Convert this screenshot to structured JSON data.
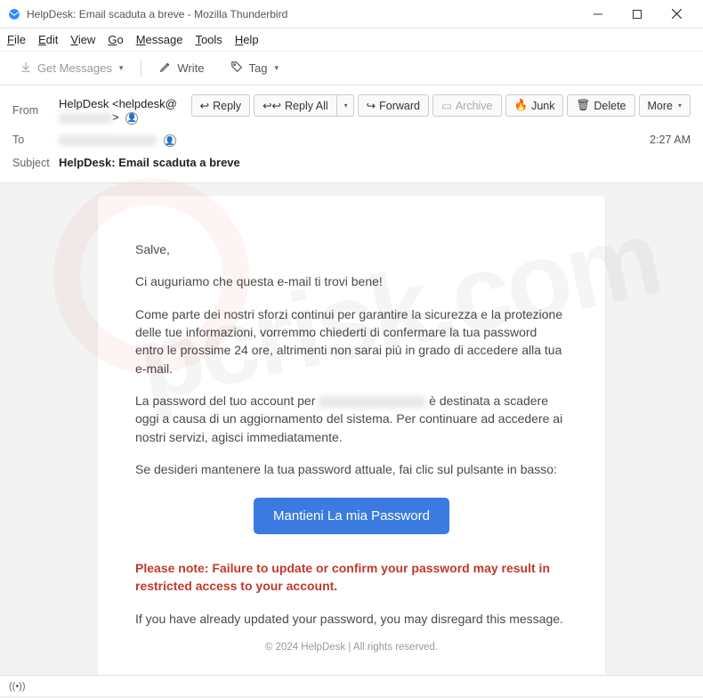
{
  "window": {
    "title": "HelpDesk: Email scaduta a breve - Mozilla Thunderbird"
  },
  "menu": {
    "file": "File",
    "edit": "Edit",
    "view": "View",
    "go": "Go",
    "message": "Message",
    "tools": "Tools",
    "help": "Help"
  },
  "toolbar": {
    "get_messages": "Get Messages",
    "write": "Write",
    "tag": "Tag"
  },
  "actions": {
    "reply": "Reply",
    "reply_all": "Reply All",
    "forward": "Forward",
    "archive": "Archive",
    "junk": "Junk",
    "delete": "Delete",
    "more": "More"
  },
  "headers": {
    "from_label": "From",
    "from_name": "HelpDesk",
    "from_prefix": "<helpdesk@",
    "from_suffix": ">",
    "to_label": "To",
    "subject_label": "Subject",
    "subject": "HelpDesk: Email scaduta a breve",
    "time": "2:27 AM"
  },
  "email": {
    "greeting": "Salve,",
    "intro": "Ci auguriamo che questa e-mail ti trovi bene!",
    "p1": "Come parte dei nostri sforzi continui per garantire la sicurezza e la protezione delle tue informazioni, vorremmo chiederti di confermare la tua password entro le prossime 24 ore, altrimenti non sarai più in grado di accedere alla tua e-mail.",
    "p2a": "La password del tuo account per ",
    "p2b": " è destinata a scadere oggi a causa di un aggiornamento del sistema. Per continuare ad accedere ai nostri servizi, agisci immediatamente.",
    "p3": "Se desideri mantenere la tua password attuale, fai clic sul pulsante in basso:",
    "cta": "Mantieni La mia Password",
    "note": "Please note: Failure to update or confirm your password may result in restricted access to your account.",
    "disregard": "If you have already updated your password, you may disregard this message.",
    "footer": "© 2024 HelpDesk | All rights reserved."
  },
  "status": {
    "icon": "((•))"
  }
}
